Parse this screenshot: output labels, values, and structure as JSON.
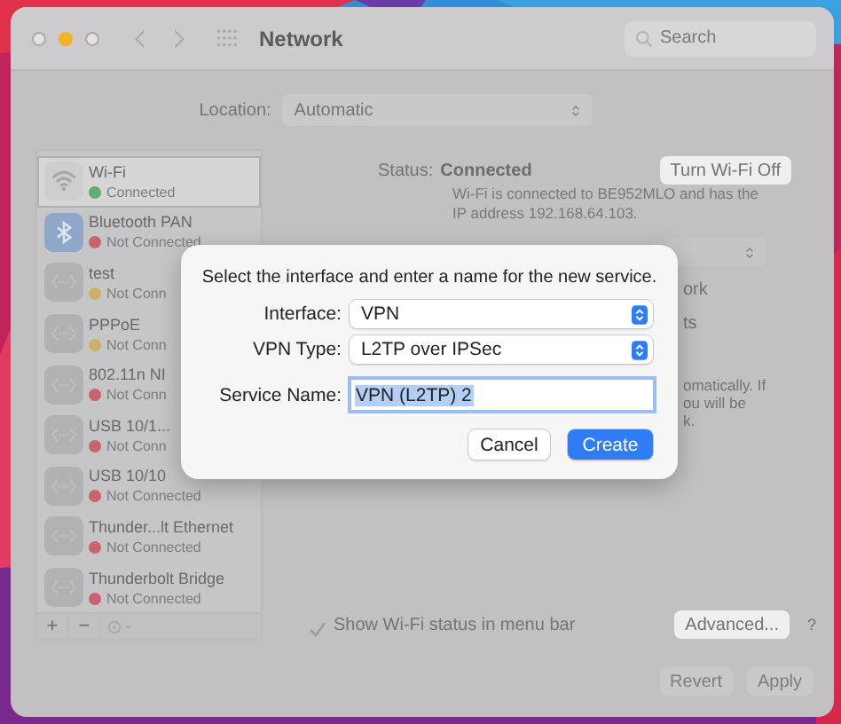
{
  "window": {
    "title": "Network",
    "search": {
      "placeholder": "Search"
    }
  },
  "location": {
    "label": "Location:",
    "value": "Automatic"
  },
  "services": [
    {
      "name": "Wi-Fi",
      "status": "Connected",
      "color": "#5fae6a",
      "kind": "wifi",
      "selected": true
    },
    {
      "name": "Bluetooth PAN",
      "status": "Not Connected",
      "color": "#c8646c",
      "kind": "bluetooth",
      "selected": false
    },
    {
      "name": "test",
      "status": "Not Conn",
      "color": "#c9b265",
      "kind": "ethernet",
      "selected": false
    },
    {
      "name": "PPPoE",
      "status": "Not Conn",
      "color": "#c9b265",
      "kind": "ethernet",
      "selected": false
    },
    {
      "name": "802.11n NI",
      "status": "Not Conn",
      "color": "#c8646c",
      "kind": "ethernet",
      "selected": false
    },
    {
      "name": "USB 10/1...",
      "status": "Not Conn",
      "color": "#c8646c",
      "kind": "ethernet",
      "selected": false
    },
    {
      "name": "USB 10/10",
      "status": "Not Connected",
      "color": "#c8646c",
      "kind": "ethernet",
      "selected": false
    },
    {
      "name": "Thunder...lt Ethernet",
      "status": "Not Connected",
      "color": "#c8646c",
      "kind": "ethernet",
      "selected": false
    },
    {
      "name": "Thunderbolt Bridge",
      "status": "Not Connected",
      "color": "#c8646c",
      "kind": "ethernet",
      "selected": false
    }
  ],
  "sidebar_toolbar": [
    "+",
    "−"
  ],
  "status": {
    "label": "Status:",
    "value": "Connected",
    "button": "Turn Wi-Fi Off",
    "description": [
      "Wi-Fi is connected to BE952MLO and has the",
      "IP address 192.168.64.103."
    ]
  },
  "obscured_fragments": [
    {
      "kind": "popup"
    },
    {
      "kind": "text",
      "text": "ork"
    },
    {
      "kind": "text",
      "text": "ts"
    },
    {
      "kind": "note",
      "lines": [
        "omatically. If",
        "ou will be",
        "k."
      ]
    }
  ],
  "show_status": {
    "label": "Show Wi-Fi status in menu bar",
    "checked": true
  },
  "advanced_button": "Advanced...",
  "help_button": "?",
  "footer_buttons": [
    "Revert",
    "Apply"
  ],
  "dialog": {
    "message": "Select the interface and enter a name for the new service.",
    "fields": [
      {
        "label": "Interface:",
        "value": "VPN",
        "kind": "popup"
      },
      {
        "label": "VPN Type:",
        "value": "L2TP over IPSec",
        "kind": "popup"
      },
      {
        "label": "Service Name:",
        "value": "VPN (L2TP) 2",
        "kind": "text",
        "selected": true
      }
    ],
    "buttons": [
      {
        "label": "Cancel",
        "default": false
      },
      {
        "label": "Create",
        "default": true
      }
    ]
  }
}
